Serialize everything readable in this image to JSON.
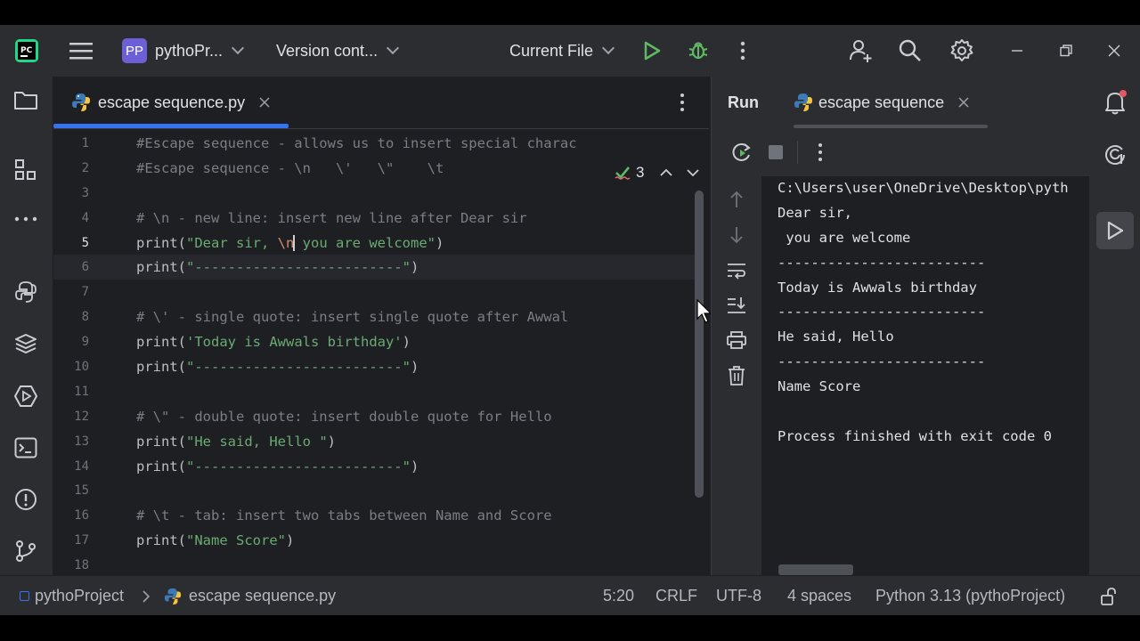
{
  "titlebar": {
    "project_badge": "PP",
    "project_name": "pythoPr...",
    "vcs": "Version cont...",
    "run_config": "Current File"
  },
  "editor": {
    "tab_label": "escape sequence.py",
    "problems_count": "3",
    "current_line": 5,
    "line_numbers": [
      "1",
      "2",
      "3",
      "4",
      "5",
      "6",
      "7",
      "8",
      "9",
      "10",
      "11",
      "12",
      "13",
      "14",
      "15",
      "16",
      "17",
      "18"
    ],
    "code_lines": [
      "#Escape sequence - allows us to insert special charac",
      "#Escape sequence - \\n   \\'   \\\"    \\t",
      "",
      "# \\n - new line: insert new line after Dear sir",
      "print(\"Dear sir, \\n you are welcome\")",
      "print(\"-------------------------\")",
      "",
      "# \\' - single quote: insert single quote after Awwal",
      "print('Today is Awwals birthday')",
      "print(\"-------------------------\")",
      "",
      "# \\\" - double quote: insert double quote for Hello",
      "print(\"He said, Hello \")",
      "print(\"-------------------------\")",
      "",
      "# \\t - tab: insert two tabs between Name and Score",
      "print(\"Name Score\")",
      ""
    ]
  },
  "run": {
    "title": "Run",
    "tab_label": "escape sequence",
    "output_lines": [
      "C:\\Users\\user\\OneDrive\\Desktop\\pyth",
      "Dear sir,",
      " you are welcome",
      "-------------------------",
      "Today is Awwals birthday",
      "-------------------------",
      "He said, Hello",
      "-------------------------",
      "Name Score",
      "",
      "Process finished with exit code 0"
    ]
  },
  "statusbar": {
    "project": "pythoProject",
    "file": "escape sequence.py",
    "position": "5:20",
    "line_ending": "CRLF",
    "encoding": "UTF-8",
    "indent": "4 spaces",
    "interpreter": "Python 3.13 (pythoProject)"
  },
  "colors": {
    "accent": "#3574f0",
    "run_green": "#5fb865",
    "string_green": "#6aab73",
    "comment_gray": "#7a7e85",
    "escape_orange": "#cf8e6d"
  },
  "icons": [
    "app-logo-icon",
    "main-menu-icon",
    "run-icon",
    "debug-icon",
    "more-icon",
    "add-user-icon",
    "search-icon",
    "settings-icon",
    "minimize-icon",
    "restore-icon",
    "close-icon",
    "project-folder-icon",
    "structure-icon",
    "more-tools-icon",
    "python-console-icon",
    "python-packages-icon",
    "services-icon",
    "terminal-icon",
    "problems-icon",
    "git-icon",
    "python-file-icon",
    "rerun-icon",
    "stop-icon",
    "scroll-up-icon",
    "scroll-down-icon",
    "soft-wrap-icon",
    "scroll-to-end-icon",
    "print-icon",
    "trash-icon",
    "notifications-icon",
    "ai-assistant-icon",
    "run-tool-icon",
    "lock-icon"
  ]
}
